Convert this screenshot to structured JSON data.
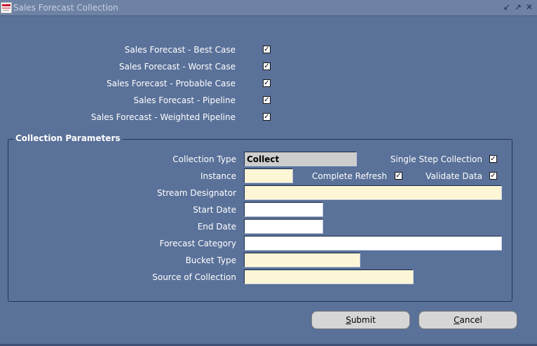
{
  "window": {
    "title": "Sales Forecast Collection",
    "controls": [
      "minimize-icon",
      "maximize-icon",
      "close-icon"
    ]
  },
  "forecast_options": [
    {
      "label": "Sales Forecast - Best Case",
      "checked": true
    },
    {
      "label": "Sales Forecast - Worst Case",
      "checked": true
    },
    {
      "label": "Sales Forecast - Probable Case",
      "checked": true
    },
    {
      "label": "Sales Forecast - Pipeline",
      "checked": true
    },
    {
      "label": "Sales Forecast - Weighted Pipeline",
      "checked": true
    }
  ],
  "params": {
    "title": "Collection Parameters",
    "collection_type_label": "Collection Type",
    "collection_type_value": "Collect",
    "single_step_label": "Single Step Collection",
    "single_step_checked": true,
    "instance_label": "Instance",
    "instance_value": "",
    "complete_refresh_label": "Complete Refresh",
    "complete_refresh_checked": true,
    "validate_data_label": "Validate Data",
    "validate_data_checked": true,
    "stream_designator_label": "Stream Designator",
    "stream_designator_value": "",
    "start_date_label": "Start Date",
    "start_date_value": "",
    "end_date_label": "End Date",
    "end_date_value": "",
    "forecast_category_label": "Forecast Category",
    "forecast_category_value": "",
    "bucket_type_label": "Bucket Type",
    "bucket_type_value": "",
    "source_label": "Source of Collection",
    "source_value": ""
  },
  "buttons": {
    "submit_mnemonic": "S",
    "submit_rest": "ubmit",
    "cancel_mnemonic": "C",
    "cancel_rest": "ancel"
  },
  "colors": {
    "background": "#5a7199",
    "required_field": "#fdf6d6",
    "optional_field": "#ffffff",
    "readonly_field": "#cdcdcd"
  }
}
